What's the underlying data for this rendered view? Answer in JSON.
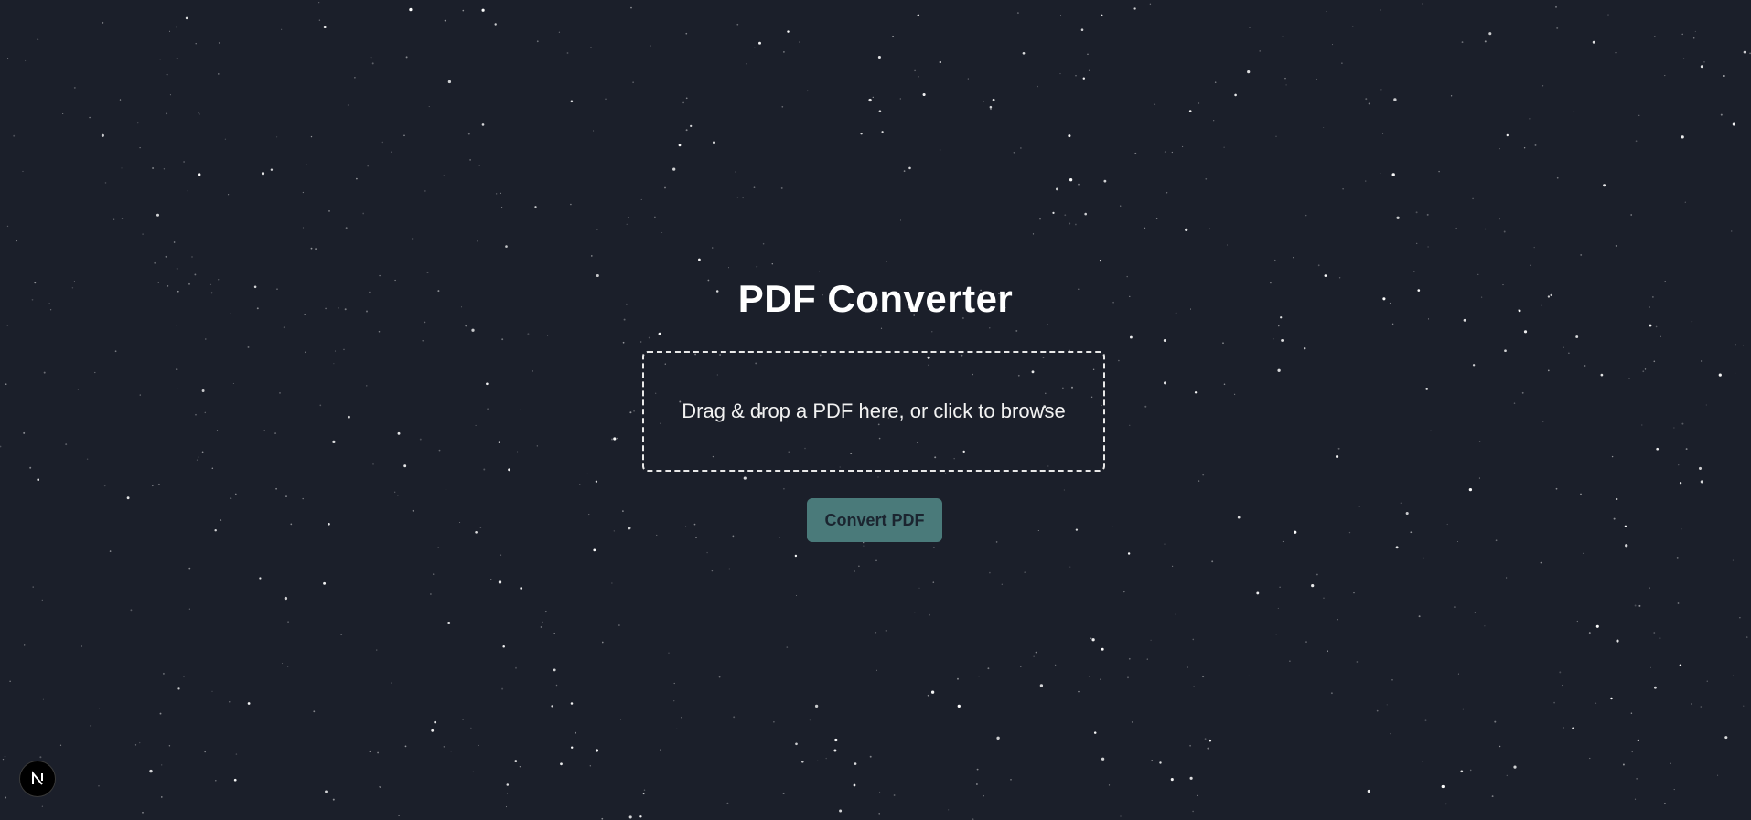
{
  "app": {
    "title": "PDF Converter"
  },
  "dropzone": {
    "prompt": "Drag & drop a PDF here, or click to browse"
  },
  "actions": {
    "convert_label": "Convert PDF"
  },
  "dev_indicator": {
    "icon": "nextjs-logo-icon"
  },
  "colors": {
    "background": "#1b1f2a",
    "star": "#ffffff",
    "button_bg": "#4a7a7a",
    "button_text": "#1b2530",
    "title": "#ffffff"
  }
}
